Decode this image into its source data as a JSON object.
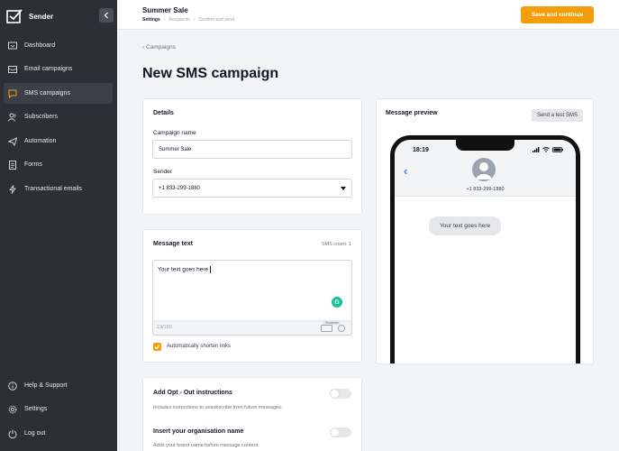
{
  "app": {
    "name": "Sender"
  },
  "sidebar": {
    "items": [
      {
        "label": "Dashboard",
        "icon": "dashboard-icon"
      },
      {
        "label": "Email campaigns",
        "icon": "mail-icon"
      },
      {
        "label": "SMS campaigns",
        "icon": "chat-icon",
        "active": true
      },
      {
        "label": "Subscribers",
        "icon": "users-icon"
      },
      {
        "label": "Automation",
        "icon": "send-icon"
      },
      {
        "label": "Forms",
        "icon": "forms-icon"
      },
      {
        "label": "Transactional emails",
        "icon": "lightning-icon"
      }
    ],
    "bottom": [
      {
        "label": "Help & Support",
        "icon": "info-icon"
      },
      {
        "label": "Settings",
        "icon": "gear-icon"
      },
      {
        "label": "Log out",
        "icon": "power-icon"
      }
    ]
  },
  "header": {
    "title": "Summer Sale",
    "steps": [
      "Settings",
      "Recipients",
      "Confirm and send"
    ],
    "save_label": "Save and continue"
  },
  "main": {
    "back_label": "Campaigns",
    "page_title": "New SMS campaign",
    "details": {
      "title": "Details",
      "campaign_name_label": "Campaign name",
      "campaign_name_value": "Summer Sale",
      "sender_label": "Sender",
      "sender_value": "+1 833-299-1880"
    },
    "message": {
      "title": "Message text",
      "sms_count": "SMS count: 1",
      "text": "Your text goes here",
      "char_count": "19/160",
      "tool_tag": "Shortener",
      "shorten_label": "Automatically shorten links",
      "shorten_checked": true
    },
    "opt_out": {
      "title": "Add Opt - Out instructions",
      "description": "Includes instructions to unsubscribe from future messages.",
      "enabled": false
    },
    "org_name": {
      "title": "Insert your organisation name",
      "description": "Adds your brand name before message content.",
      "enabled": false
    },
    "preview": {
      "title": "Message preview",
      "test_label": "Send a test SMS",
      "time": "18:19",
      "contact_number": "+1 833-299-1880",
      "bubble_text": "Your text goes here"
    }
  },
  "colors": {
    "accent": "#f59e0b",
    "sidebar": "#2c2f36",
    "ios_blue": "#3b82f6"
  }
}
